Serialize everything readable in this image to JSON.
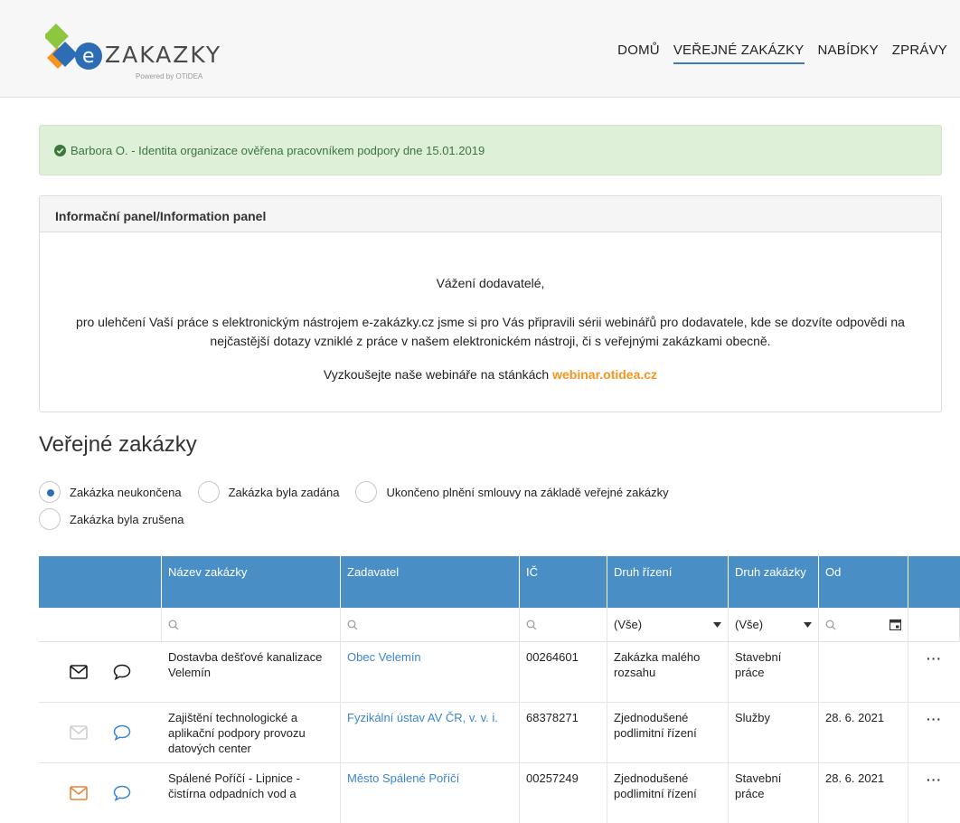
{
  "header": {
    "logo_text": "ZAKAZKY",
    "logo_sub": "Powered by OTIDEA",
    "nav": [
      "DOMŮ",
      "VEŘEJNÉ ZAKÁZKY",
      "NABÍDKY",
      "ZPRÁVY"
    ],
    "active_nav": "VEŘEJNÉ ZAKÁZKY"
  },
  "alert": {
    "text": "Barbora O. - Identita organizace ověřena pracovníkem podpory dne 15.01.2019"
  },
  "panel": {
    "title": "Informační panel/Information panel",
    "greeting": "Vážení dodavatelé,",
    "body": "pro ulehčení Vaší práce s elektronickým nástrojem e-zakázky.cz jsme si pro Vás připravili sérii webinářů pro dodavatele, kde se dozvíte odpovědi na nejčastější dotazy vzniklé z práce v našem elektronickém nástroji, či s veřejnými zakázkami obecně.",
    "cta_prefix": "Vyzkoušejte naše webináře na stánkách",
    "cta_link": "webinar.otidea.cz"
  },
  "section": {
    "title": "Veřejné zakázky",
    "filters": [
      {
        "label": "Zakázka neukončena",
        "selected": true
      },
      {
        "label": "Zakázka byla zadána",
        "selected": false
      },
      {
        "label": "Ukončeno plnění smlouvy na základě veřejné zakázky",
        "selected": false
      },
      {
        "label": "Zakázka byla zrušena",
        "selected": false
      }
    ]
  },
  "table": {
    "columns": [
      "",
      "Název zakázky",
      "Zadavatel",
      "IČ",
      "Druh řízení",
      "Druh zakázky",
      "Od",
      ""
    ],
    "filter_row": {
      "druh_rizeni": "(Vše)",
      "druh_zakazky": "(Vše)"
    },
    "rows": [
      {
        "mail_color": "#1a1a1a",
        "chat_color": "#1a1a1a",
        "name": "Dostavba dešťové kanalizace Velemín",
        "zadavatel": "Obec Velemín",
        "ic": "00264601",
        "druh_rizeni": "Zakázka malého rozsahu",
        "druh_zakazky": "Stavební práce",
        "od": "",
        "more": "···"
      },
      {
        "mail_color": "#cfcfcf",
        "chat_color": "#3b85d0",
        "name": "Zajištění technologické a aplikační podpory provozu datových center",
        "zadavatel": "Fyzikální ústav AV ČR, v. v. i.",
        "ic": "68378271",
        "druh_rizeni": "Zjednodušené podlimitní řízení",
        "druh_zakazky": "Služby",
        "od": "28. 6. 2021",
        "more": "···"
      },
      {
        "mail_color": "#e8843e",
        "chat_color": "#3b85d0",
        "name": "Spálené Poříčí - Lipnice - čistírna odpadních vod a",
        "zadavatel": "Město Spálené Poříčí",
        "ic": "00257249",
        "druh_rizeni": "Zjednodušené podlimitní řízení",
        "druh_zakazky": "Stavební práce",
        "od": "28. 6. 2021",
        "more": "···"
      }
    ]
  }
}
